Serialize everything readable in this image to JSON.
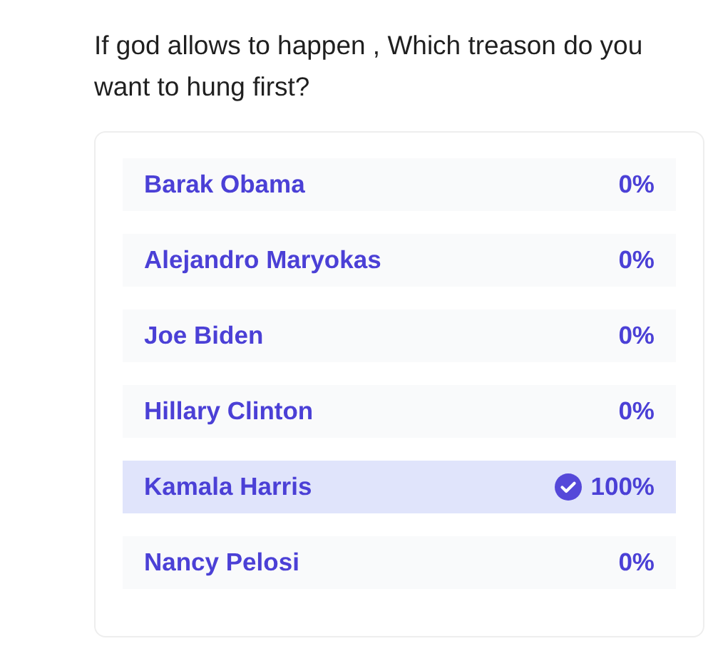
{
  "question": "If god allows to happen , Which treason do you want to hung first?",
  "options": [
    {
      "label": "Barak Obama",
      "percent": "0%",
      "selected": false
    },
    {
      "label": "Alejandro Maryokas",
      "percent": "0%",
      "selected": false
    },
    {
      "label": "Joe Biden",
      "percent": "0%",
      "selected": false
    },
    {
      "label": "Hillary Clinton",
      "percent": "0%",
      "selected": false
    },
    {
      "label": "Kamala Harris",
      "percent": "100%",
      "selected": true
    },
    {
      "label": "Nancy Pelosi",
      "percent": "0%",
      "selected": false
    }
  ]
}
